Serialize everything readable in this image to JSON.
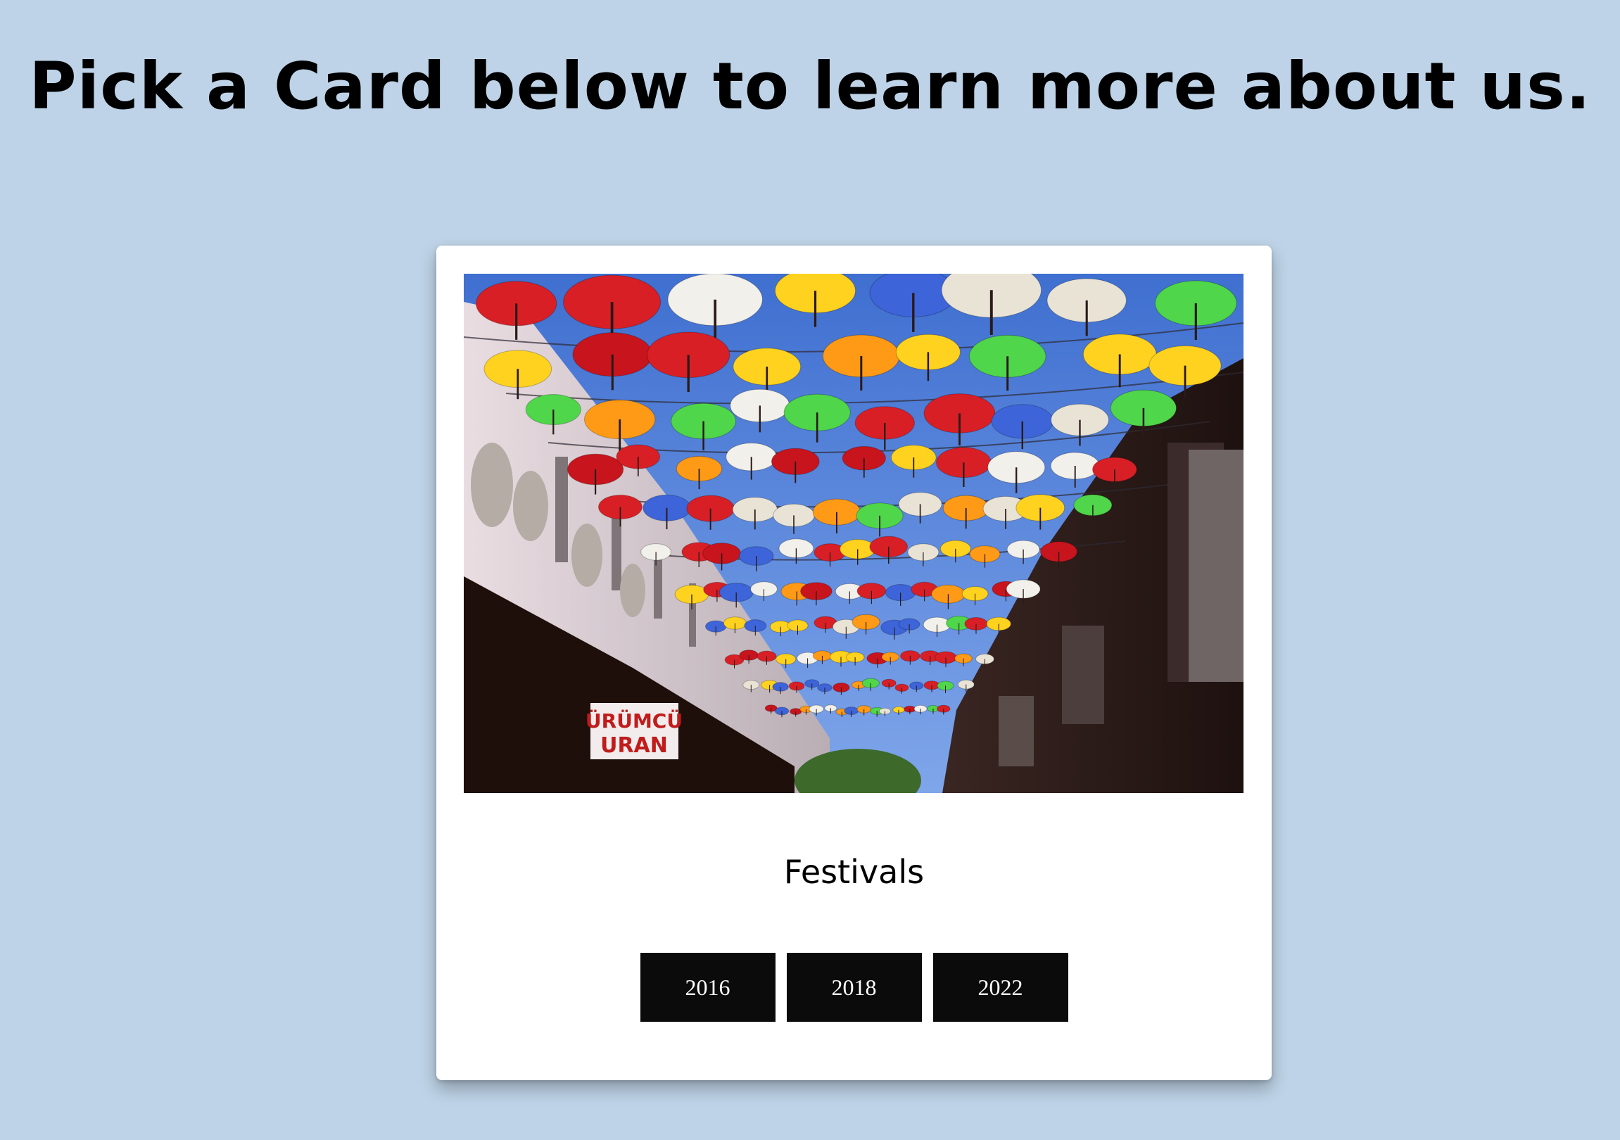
{
  "page": {
    "heading": "Pick a Card below to learn more about us."
  },
  "card": {
    "image_description": "umbrella-street-photo",
    "title": "Festivals",
    "buttons": [
      {
        "label": "2016"
      },
      {
        "label": "2018"
      },
      {
        "label": "2022"
      }
    ]
  },
  "photo_sign": {
    "line1": "ÜRÜMCÜ",
    "line2": "URAN"
  },
  "colors": {
    "background": "#bed3e7",
    "card": "#ffffff",
    "button": "#0b0b0b",
    "button_text": "#ffffff"
  }
}
